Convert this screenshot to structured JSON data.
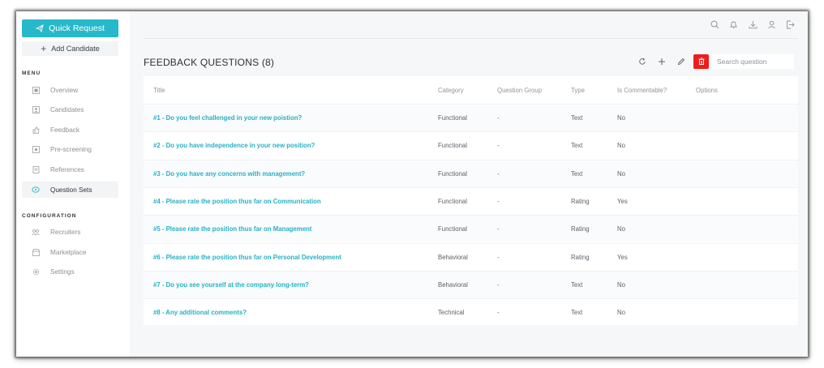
{
  "sidebar": {
    "quick_request": "Quick Request",
    "add_candidate": "Add Candidate",
    "menu_title": "MENU",
    "menu_items": [
      {
        "label": "Overview",
        "icon": "overview-icon"
      },
      {
        "label": "Candidates",
        "icon": "candidates-icon"
      },
      {
        "label": "Feedback",
        "icon": "thumbs-up-icon"
      },
      {
        "label": "Pre-screening",
        "icon": "prescreening-icon"
      },
      {
        "label": "References",
        "icon": "references-icon"
      },
      {
        "label": "Question Sets",
        "icon": "question-sets-icon",
        "active": true
      }
    ],
    "config_title": "CONFIGURATION",
    "config_items": [
      {
        "label": "Recruiters",
        "icon": "recruiters-icon"
      },
      {
        "label": "Marketplace",
        "icon": "marketplace-icon"
      },
      {
        "label": "Settings",
        "icon": "gear-icon"
      }
    ]
  },
  "topbar": {
    "icons": [
      "search-icon",
      "bell-icon",
      "download-icon",
      "user-icon",
      "logout-icon"
    ]
  },
  "page": {
    "title": "FEEDBACK QUESTIONS (8)",
    "search_placeholder": "Search question",
    "accent_color": "#26b9c9",
    "danger_color": "#f01c1c"
  },
  "table": {
    "headers": {
      "title": "Title",
      "category": "Category",
      "group": "Question Group",
      "type": "Type",
      "commentable": "Is Commentable?",
      "options": "Options"
    },
    "rows": [
      {
        "title": "#1 - Do you feel challenged in your new poistion?",
        "category": "Functional",
        "group": "-",
        "type": "Text",
        "commentable": "No"
      },
      {
        "title": "#2 - Do you have independence in your new position?",
        "category": "Functional",
        "group": "-",
        "type": "Text",
        "commentable": "No"
      },
      {
        "title": "#3 - Do you have any concerns with management?",
        "category": "Functional",
        "group": "-",
        "type": "Text",
        "commentable": "No"
      },
      {
        "title": "#4 - Please rate the position thus far on Communication",
        "category": "Functional",
        "group": "-",
        "type": "Rating",
        "commentable": "Yes"
      },
      {
        "title": "#5 - Please rate the position thus far on Management",
        "category": "Functional",
        "group": "-",
        "type": "Rating",
        "commentable": "No"
      },
      {
        "title": "#6 - Please rate the position thus far on Personal Development",
        "category": "Behavioral",
        "group": "-",
        "type": "Rating",
        "commentable": "Yes"
      },
      {
        "title": "#7 - Do you see yourself at the company long-term?",
        "category": "Behavioral",
        "group": "-",
        "type": "Text",
        "commentable": "No"
      },
      {
        "title": "#8 - Any additional comments?",
        "category": "Technical",
        "group": "-",
        "type": "Text",
        "commentable": "No"
      }
    ]
  }
}
